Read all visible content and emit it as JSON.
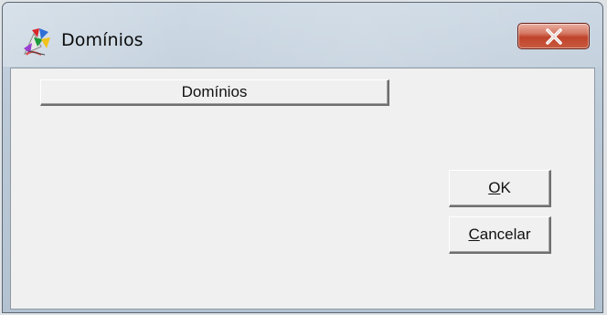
{
  "window": {
    "title": "Domínios",
    "icon": "app-icon"
  },
  "tab_button": {
    "label": "Domínios"
  },
  "buttons": {
    "ok": {
      "mnemonic": "O",
      "rest": "K"
    },
    "cancel": {
      "mnemonic": "C",
      "rest": "ancelar"
    }
  },
  "colors": {
    "client_background": "#f0f0f0",
    "close_button": "#c0432b",
    "title_bar": "#c9d6e2"
  }
}
